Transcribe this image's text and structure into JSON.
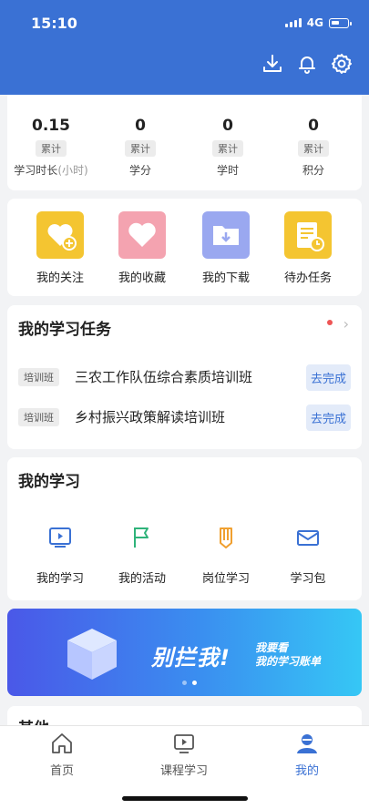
{
  "status_bar": {
    "time": "15:10",
    "network": "4G"
  },
  "stats": [
    {
      "value": "0.15",
      "tag": "累计",
      "label": "学习时长",
      "label_suffix": "(小时)"
    },
    {
      "value": "0",
      "tag": "累计",
      "label": "学分",
      "label_suffix": ""
    },
    {
      "value": "0",
      "tag": "累计",
      "label": "学时",
      "label_suffix": ""
    },
    {
      "value": "0",
      "tag": "累计",
      "label": "积分",
      "label_suffix": ""
    }
  ],
  "quick_actions": [
    {
      "label": "我的关注",
      "icon": "heart-plus-icon",
      "color": "#f4c531"
    },
    {
      "label": "我的收藏",
      "icon": "heart-icon",
      "color": "#f4a3b0"
    },
    {
      "label": "我的下载",
      "icon": "download-folder-icon",
      "color": "#9aa8f0"
    },
    {
      "label": "待办任务",
      "icon": "todo-doc-icon",
      "color": "#f4c531"
    }
  ],
  "tasks": {
    "title": "我的学习任务",
    "items": [
      {
        "badge": "培训班",
        "name": "三农工作队伍综合素质培训班",
        "action": "去完成"
      },
      {
        "badge": "培训班",
        "name": "乡村振兴政策解读培训班",
        "action": "去完成"
      }
    ]
  },
  "study": {
    "title": "我的学习",
    "items": [
      {
        "label": "我的学习",
        "icon": "play-screen-icon"
      },
      {
        "label": "我的活动",
        "icon": "flag-icon"
      },
      {
        "label": "岗位学习",
        "icon": "pencil-icon"
      },
      {
        "label": "学习包",
        "icon": "envelope-icon"
      }
    ]
  },
  "banner": {
    "headline": "别拦我!",
    "sub_line1": "我要看",
    "sub_line2": "我的学习账单"
  },
  "other": {
    "title": "其他"
  },
  "tabbar": [
    {
      "label": "首页",
      "icon": "home-icon",
      "active": false
    },
    {
      "label": "课程学习",
      "icon": "course-play-icon",
      "active": false
    },
    {
      "label": "我的",
      "icon": "user-icon",
      "active": true
    }
  ],
  "colors": {
    "primary": "#3a71d4",
    "background": "#f2f3f5"
  }
}
